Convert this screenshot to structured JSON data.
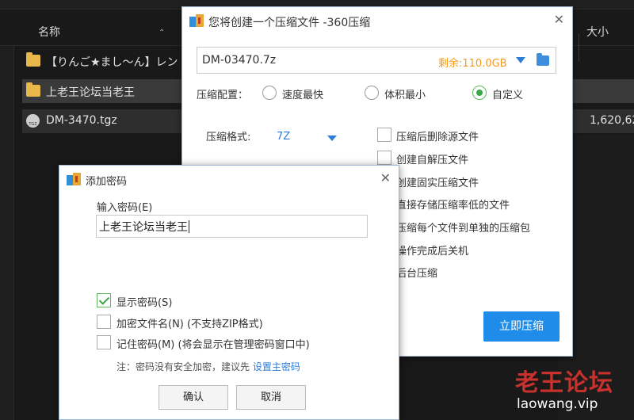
{
  "explorer": {
    "col_name": "名称",
    "col_size": "大小",
    "files": [
      {
        "name": "【りんご★まし～ん】レン",
        "size": "",
        "type": "folder"
      },
      {
        "name": "上老王论坛当老王",
        "size": "",
        "type": "folder"
      },
      {
        "name": "DM-3470.tgz",
        "size": "1,620,62",
        "type": "tgz"
      }
    ],
    "tgz_icon_text": "TGZ"
  },
  "create_dialog": {
    "title": "您将创建一个压缩文件 -360压缩",
    "path": "DM-03470.7z",
    "free_space": "剩余:110.0GB",
    "config_label": "压缩配置：",
    "radios": [
      {
        "label": "速度最快",
        "selected": false
      },
      {
        "label": "体积最小",
        "selected": false
      },
      {
        "label": "自定义",
        "selected": true
      }
    ],
    "format_label": "压缩格式:",
    "format_value": "7Z",
    "options": [
      "压缩后删除源文件",
      "创建自解压文件",
      "创建固实压缩文件",
      "直接存储压缩率低的文件",
      "压缩每个文件到单独的压缩包",
      "操作完成后关机",
      "后台压缩"
    ],
    "start_button": "立即压缩"
  },
  "password_dialog": {
    "title": "添加密码",
    "input_label": "输入密码(E)",
    "password_value": "上老王论坛当老王",
    "checkboxes": [
      {
        "label": "显示密码(S)",
        "checked": true
      },
      {
        "label": "加密文件名(N) (不支持ZIP格式)",
        "checked": false
      },
      {
        "label": "记住密码(M) (将会显示在管理密码窗口中)",
        "checked": false
      }
    ],
    "note_text": "注：密码没有安全加密，建议先 ",
    "note_link": "设置主密码",
    "ok_button": "确认",
    "cancel_button": "取消"
  },
  "watermark": {
    "cn": "老王论坛",
    "url": "laowang.vip"
  },
  "colors": {
    "accent_blue": "#1e8ce8",
    "free_space_orange": "#f39a1e",
    "check_green": "#3aa64a",
    "watermark_red": "#c9312d"
  }
}
